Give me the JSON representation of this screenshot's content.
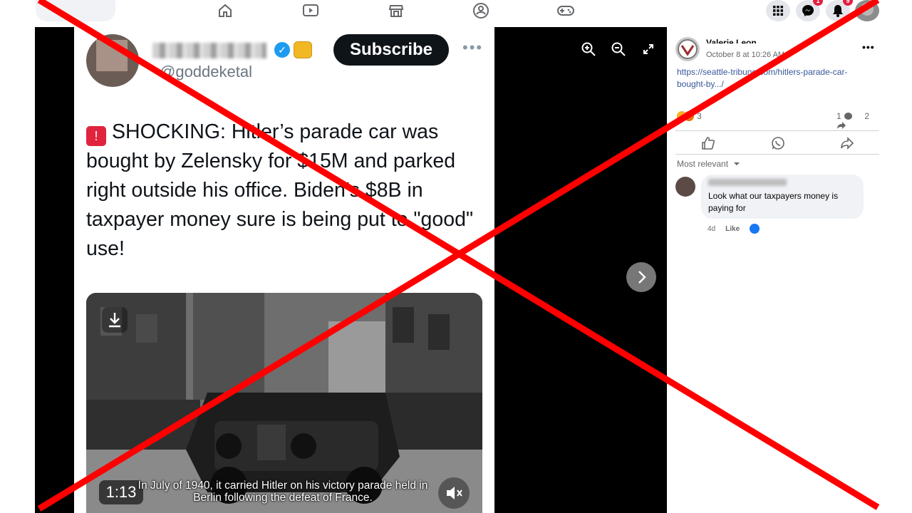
{
  "topbar": {
    "nav_icons": [
      "home-icon",
      "watch-icon",
      "marketplace-icon",
      "groups-icon",
      "gaming-icon"
    ],
    "messenger_badge": "1",
    "notifications_badge": "9"
  },
  "tweet": {
    "handle": "@goddeketal",
    "subscribe_label": "Subscribe",
    "text": "SHOCKING: Hitler’s parade car was bought by Zelensky for $15M and parked right outside his office. Biden’s $8B in taxpayer money sure is being put to \"good\" use!",
    "video": {
      "time": "1:13",
      "subtitle": "In July of 1940, it carried Hitler on his victory parade held in Berlin following the defeat of France."
    }
  },
  "post": {
    "author": "Valerie Leon",
    "time": "October 8 at 10:26 AM",
    "link": "https://seattle-tribune.com/hitlers-parade-car-bought-by.../",
    "reactions_count": "3",
    "comments_count": "1",
    "shares_count": "2",
    "sort_label": "Most relevant",
    "comment": {
      "text": "Look what our taxpayers money is paying for",
      "age": "4d",
      "like_label": "Like"
    }
  },
  "colors": {
    "overlay_x": "#ff0000",
    "link": "#385898",
    "subscribe_bg": "#0f1419"
  }
}
